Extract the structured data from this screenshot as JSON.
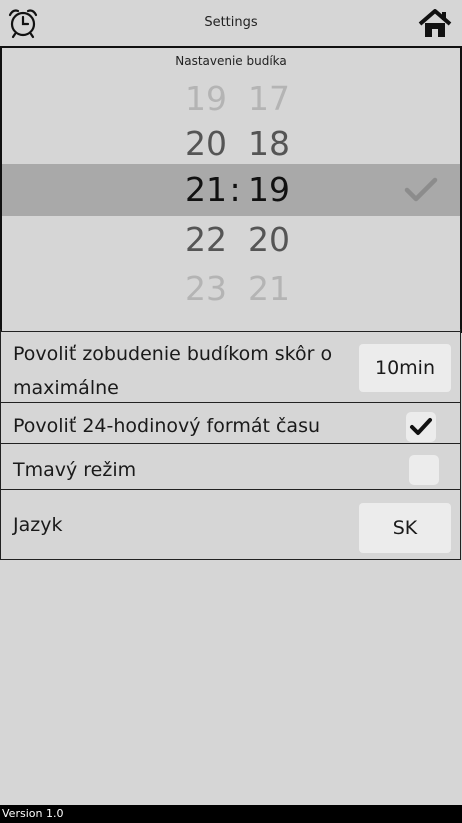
{
  "header": {
    "title": "Settings",
    "left_icon": "alarm-clock-icon",
    "right_icon": "home-icon"
  },
  "picker": {
    "caption": "Nastavenie budíka",
    "rows": [
      {
        "hour": "19",
        "minute": "17"
      },
      {
        "hour": "20",
        "minute": "18"
      },
      {
        "hour": "21",
        "minute": "19",
        "separator": ":"
      },
      {
        "hour": "22",
        "minute": "20"
      },
      {
        "hour": "23",
        "minute": "21"
      }
    ]
  },
  "settings": {
    "early_wake": {
      "label_line1": "Povoliť zobudenie budíkom skôr o",
      "label_line2": "maximálne",
      "value": "10min"
    },
    "format_24h": {
      "label": "Povoliť 24-hodinový formát času",
      "checked": true
    },
    "dark_mode": {
      "label": "Tmavý režim",
      "checked": false
    },
    "language": {
      "label": "Jazyk",
      "value": "SK"
    }
  },
  "footer": {
    "version": "Version 1.0"
  },
  "colors": {
    "background": "#d6d6d6",
    "selection_band": "#a9a9a9",
    "button": "#ececec",
    "footer": "#000000"
  }
}
